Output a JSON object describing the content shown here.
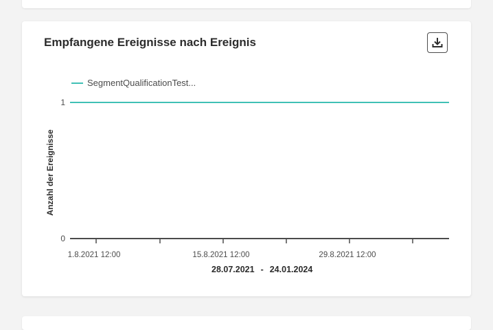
{
  "card": {
    "title": "Empfangene Ereignisse nach Ereignis",
    "download_icon": "download-icon",
    "date_range": {
      "start": "28.07.2021",
      "separator": "-",
      "end": "24.01.2024"
    }
  },
  "colors": {
    "series": "#3fc0b5",
    "axis": "#4b4b4b"
  },
  "chart_data": {
    "type": "line",
    "title": "",
    "ylabel": "Anzahl der Ereignisse",
    "xlabel": "",
    "ylim": [
      0,
      1
    ],
    "y_ticks": [
      "0",
      "1"
    ],
    "x_tick_labels": [
      "1.8.2021 12:00",
      "15.8.2021 12:00",
      "29.8.2021 12:00"
    ],
    "legend": "top-left",
    "grid": false,
    "series": [
      {
        "name": "SegmentQualificationTest...",
        "values": [
          1,
          1
        ]
      }
    ]
  }
}
